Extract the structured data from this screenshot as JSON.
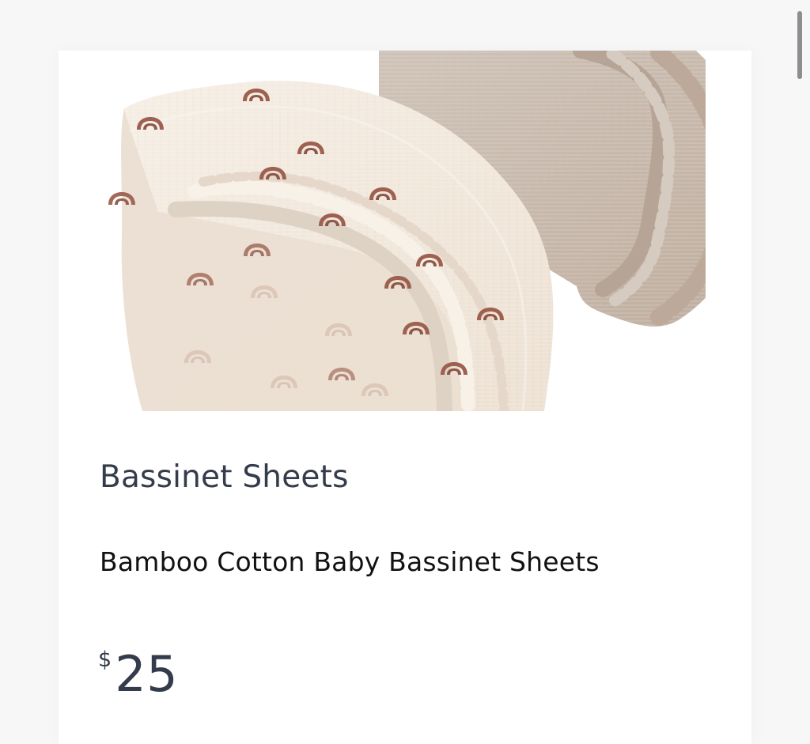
{
  "product": {
    "image_alt": "Bassinet sheets with rainbow print",
    "category": "Bassinet Sheets",
    "name": "Bamboo Cotton Baby Bassinet Sheets",
    "price_currency": "$",
    "price_amount": "25"
  },
  "colors": {
    "background": "#f7f7f7",
    "card": "#ffffff",
    "heading": "#343b4a",
    "body_text": "#111111",
    "cream_sheet": "#f3eadf",
    "tan_sheet": "#cdbfb2",
    "rainbow_print": "#9a5a49",
    "scrollbar": "#8e8e8e"
  },
  "icons": {
    "scrollbar": "vertical-scroll-thumb",
    "rainbow": "rainbow-print-icon"
  }
}
